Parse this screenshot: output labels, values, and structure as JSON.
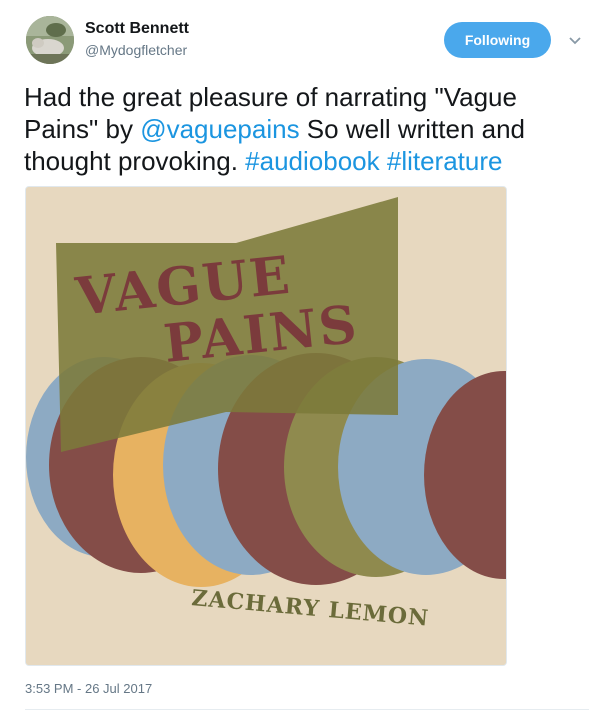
{
  "author": {
    "name": "Scott Bennett",
    "handle": "@Mydogfletcher"
  },
  "follow_button": {
    "label": "Following",
    "color": "#4aa8ec"
  },
  "menu": {
    "icon": "chevron-down-icon"
  },
  "tweet": {
    "text_before": "Had the great pleasure of narrating \"Vague Pains\" by ",
    "mention": "@vaguepains",
    "text_middle": " So well written and thought provoking. ",
    "hashtag_1": "#audiobook",
    "space": " ",
    "hashtag_2": "#literature",
    "link_color": "#1b95e0"
  },
  "media": {
    "title_line_1": "VAGUE",
    "title_line_2": "PAINS",
    "author_name": "ZACHARY LEMON"
  },
  "timestamp": "3:53 PM - 26 Jul 2017"
}
